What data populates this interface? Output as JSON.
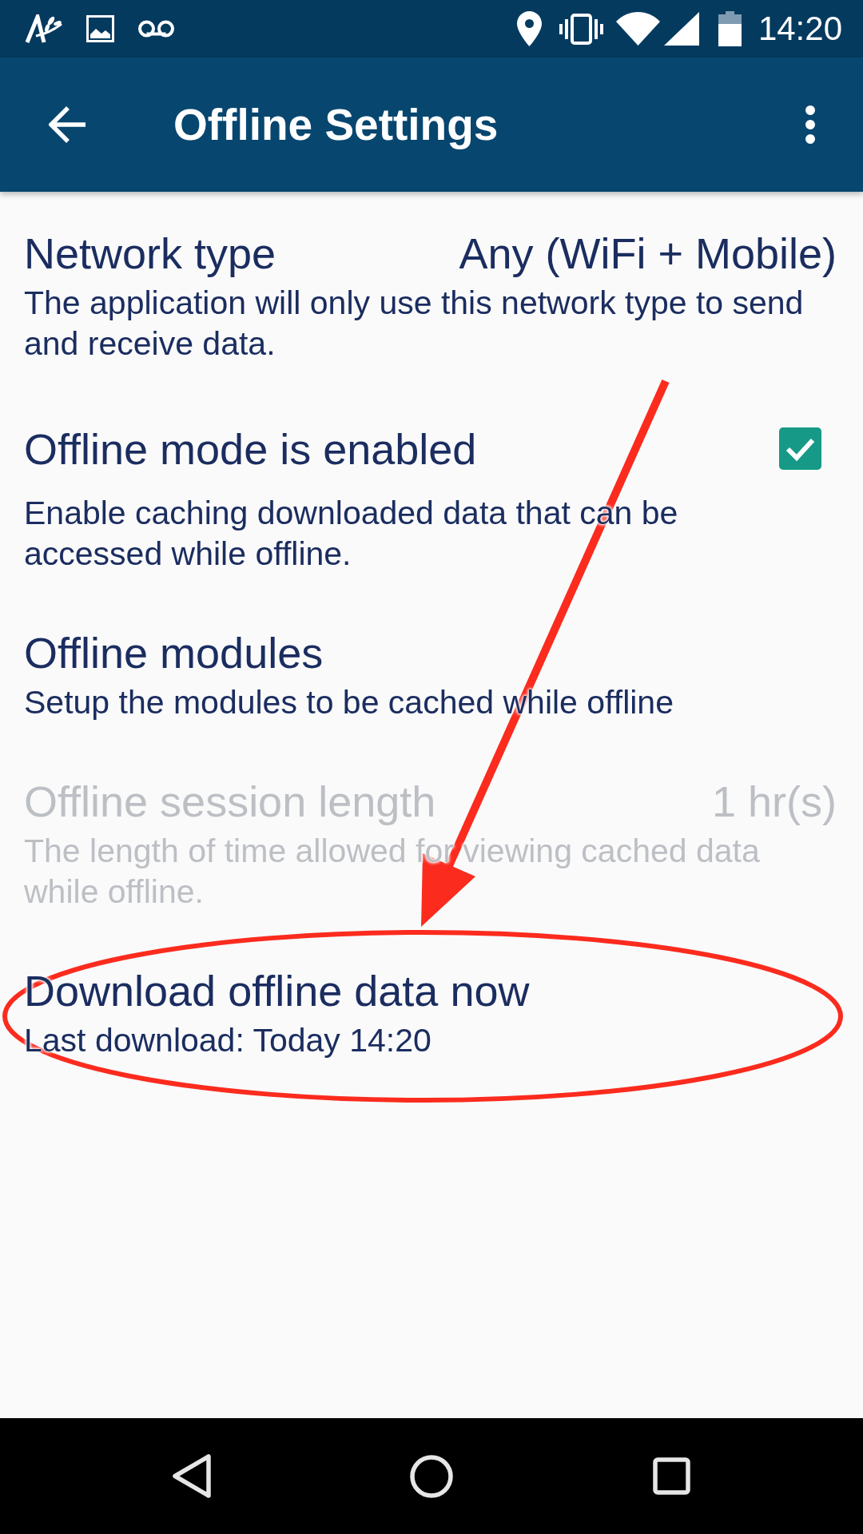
{
  "status_bar": {
    "time": "14:20"
  },
  "app_bar": {
    "title": "Offline Settings"
  },
  "settings": [
    {
      "kind": "value",
      "title": "Network type",
      "value": "Any (WiFi + Mobile)",
      "summary": "The application will only use this network type to send and receive data.",
      "disabled": false
    },
    {
      "kind": "checkbox",
      "title": "Offline mode is enabled",
      "checked": true,
      "summary": "Enable caching downloaded data that can be accessed while offline.",
      "disabled": false
    },
    {
      "kind": "plain",
      "title": "Offline modules",
      "summary": "Setup the modules to be cached while offline",
      "disabled": false
    },
    {
      "kind": "value",
      "title": "Offline session length",
      "value": "1 hr(s)",
      "summary": "The length of time allowed for viewing cached data while offline.",
      "disabled": true
    },
    {
      "kind": "plain",
      "title": "Download offline data now",
      "summary": "Last download: Today 14:20",
      "disabled": false
    }
  ]
}
